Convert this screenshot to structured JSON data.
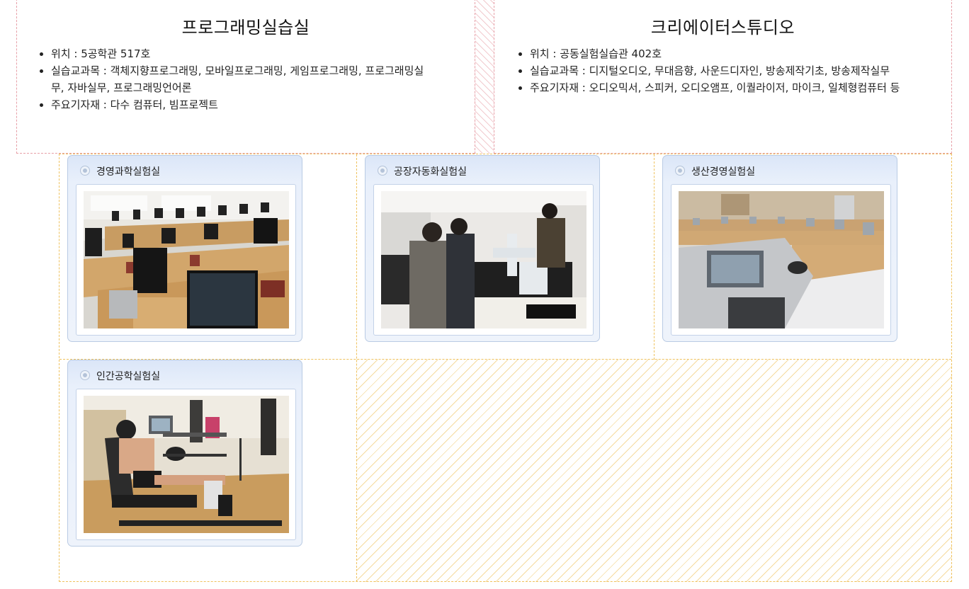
{
  "rooms": [
    {
      "title": "프로그래밍실습실",
      "items": [
        "위치 : 5공학관 517호",
        "실습교과목 : 객체지향프로그래밍, 모바일프로그래밍, 게임프로그래밍, 프로그래밍실무, 자바실무, 프로그래밍언어론",
        "주요기자재 : 다수 컴퓨터, 빔프로젝트"
      ]
    },
    {
      "title": "크리에이터스튜디오",
      "items": [
        "위치 : 공동실험실습관 402호",
        "실습교과목 : 디지털오디오, 무대음향, 사운드디자인, 방송제작기초, 방송제작실무",
        "주요기자재 : 오디오믹서, 스피커, 오디오앰프, 이퀄라이저, 마이크, 일체형컴퓨터 등"
      ]
    }
  ],
  "labs": [
    {
      "name": "경영과학실험실",
      "photo": "computer-lab-photo"
    },
    {
      "name": "공장자동화실험실",
      "photo": "robot-arm-lab-photo"
    },
    {
      "name": "생산경영실험실",
      "photo": "lecture-room-photo"
    },
    {
      "name": "인간공학실험실",
      "photo": "driving-simulator-photo"
    }
  ],
  "colors": {
    "room_border": "#e7a0a8",
    "grid_border": "#efc25e",
    "card_border": "#b9cbe4"
  }
}
